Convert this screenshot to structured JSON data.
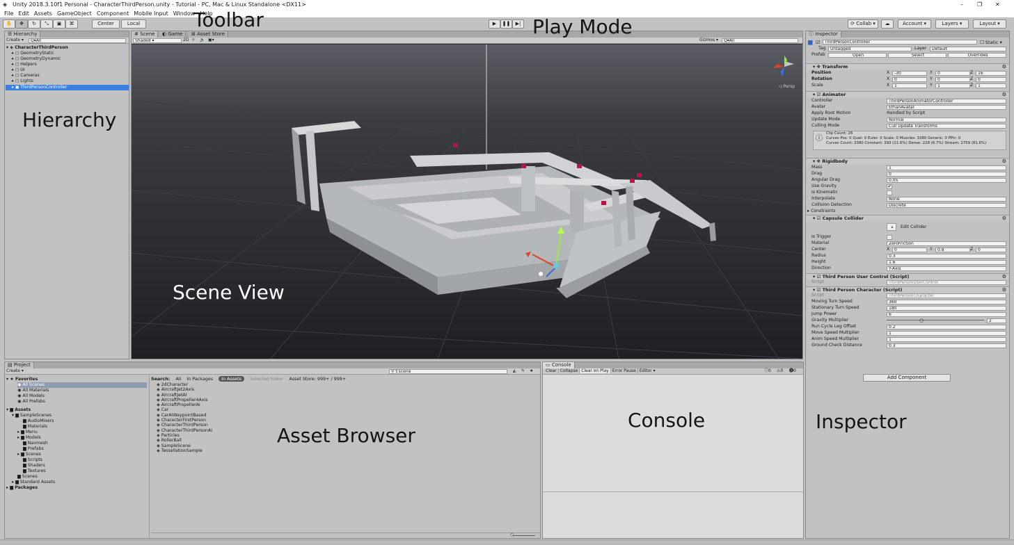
{
  "window": {
    "title": "Unity 2018.3.10f1 Personal - CharacterThirdPerson.unity - Tutorial - PC, Mac & Linux Standalone <DX11>",
    "minimize": "–",
    "maximize": "❐",
    "close": "✕"
  },
  "menu": [
    "File",
    "Edit",
    "Assets",
    "GameObject",
    "Component",
    "Mobile Input",
    "Window",
    "Help"
  ],
  "toolbar": {
    "pivot": "Center",
    "space": "Local",
    "collab": "Collab",
    "account": "Account",
    "layers": "Layers",
    "layout": "Layout",
    "play_icon": "play-icon",
    "pause_icon": "pause-icon",
    "step_icon": "step-icon"
  },
  "annotations": {
    "toolbar": "Toolbar",
    "play_mode": "Play Mode",
    "hierarchy": "Hierarchy",
    "scene_view": "Scene View",
    "asset_browser": "Asset Browser",
    "console": "Console",
    "inspector": "Inspector"
  },
  "hierarchy": {
    "tab": "Hierarchy",
    "create": "Create",
    "search": "Q▾All",
    "scene": "CharacterThirdPerson",
    "items": [
      "GeometryStatic",
      "GeometryDynamic",
      "Helpers",
      "UI",
      "Cameras",
      "Lights",
      "ThirdPersonController"
    ]
  },
  "scene": {
    "tabs": [
      "Scene",
      "Game",
      "Asset Store"
    ],
    "shading": "Shaded",
    "mode2d": "2D",
    "gizmos": "Gizmos",
    "search": "Q▾All",
    "persp": "◁ Persp"
  },
  "project": {
    "tab": "Project",
    "create": "Create",
    "search_field": "t:scene",
    "favorites_label": "Favorites",
    "favorites": [
      "All Scenes",
      "All Materials",
      "All Models",
      "All Prefabs"
    ],
    "assets_label": "Assets",
    "assets_tree": [
      "SampleScenes",
      "AudioMixers",
      "Materials",
      "Menu",
      "Models",
      "Navmesh",
      "Prefabs",
      "Scenes",
      "Scripts",
      "Shaders",
      "Textures",
      "Scenes",
      "Standard Assets"
    ],
    "packages_label": "Packages",
    "search_label": "Search:",
    "filters": [
      "All",
      "In Packages",
      "In Assets",
      "Selected folder",
      "Asset Store: 999+ / 999+"
    ],
    "results": [
      "2dCharacter",
      "AircraftJet2Axis",
      "AircraftJetAI",
      "AircraftPropeller4Axis",
      "AircraftPropellerAI",
      "Car",
      "CarAIWaypointBased",
      "CharacterFirstPerson",
      "CharacterThirdPerson",
      "CharacterThirdPersonAI",
      "Particles",
      "RollerBall",
      "SampleScene",
      "TessellationSample"
    ]
  },
  "console": {
    "tab": "Console",
    "buttons": [
      "Clear",
      "Collapse",
      "Clear on Play",
      "Error Pause",
      "Editor"
    ],
    "info_count": "0",
    "warn_count": "0",
    "error_count": "0"
  },
  "inspector": {
    "tab": "Inspector",
    "object_name": "ThirdPersonController",
    "static": "Static",
    "tag_label": "Tag",
    "tag": "Untagged",
    "layer_label": "Layer",
    "layer": "Default",
    "prefab_label": "Prefab",
    "prefab_buttons": [
      "Open",
      "Select",
      "Overrides"
    ],
    "transform": {
      "title": "Transform",
      "rows": [
        {
          "label": "Position",
          "x": "-30",
          "y": "0",
          "z": "16"
        },
        {
          "label": "Rotation",
          "x": "0",
          "y": "0",
          "z": "0"
        },
        {
          "label": "Scale",
          "x": "1",
          "y": "1",
          "z": "1"
        }
      ]
    },
    "animator": {
      "title": "Animator",
      "rows": [
        {
          "label": "Controller",
          "value": "ThirdPersonAnimatorController"
        },
        {
          "label": "Avatar",
          "value": "EthanAvatar"
        },
        {
          "label": "Apply Root Motion",
          "value": "Handled by Script"
        },
        {
          "label": "Update Mode",
          "value": "Normal"
        },
        {
          "label": "Culling Mode",
          "value": "Cull Update Transforms"
        }
      ],
      "info1": "Clip Count: 26",
      "info2": "Curves Pos: 0 Quat: 0 Euler: 0 Scale: 0 Muscles: 3380 Generic: 0 PPtr: 0",
      "info3": "Curves Count: 3380 Constant: 393 (11.6%) Dense: 228 (6.7%) Stream: 2759 (81.6%)"
    },
    "rigidbody": {
      "title": "Rigidbody",
      "rows": [
        {
          "label": "Mass",
          "value": "1"
        },
        {
          "label": "Drag",
          "value": "0"
        },
        {
          "label": "Angular Drag",
          "value": "0.05"
        },
        {
          "label": "Use Gravity",
          "value": "✔"
        },
        {
          "label": "Is Kinematic",
          "value": ""
        },
        {
          "label": "Interpolate",
          "value": "None"
        },
        {
          "label": "Collision Detection",
          "value": "Discrete"
        }
      ],
      "constraints": "Constraints"
    },
    "capsule": {
      "title": "Capsule Collider",
      "edit": "Edit Collider",
      "rows": [
        {
          "label": "Is Trigger",
          "value": ""
        },
        {
          "label": "Material",
          "value": "ZeroFriction"
        },
        {
          "label": "Radius",
          "value": "0.3"
        },
        {
          "label": "Height",
          "value": "1.6"
        },
        {
          "label": "Direction",
          "value": "Y-Axis"
        }
      ],
      "center_label": "Center",
      "center": {
        "x": "0",
        "y": "0.8",
        "z": "0"
      }
    },
    "user_control": {
      "title": "Third Person User Control (Script)",
      "script_label": "Script",
      "script": "ThirdPersonUserControl"
    },
    "character": {
      "title": "Third Person Character (Script)",
      "script_label": "Script",
      "script": "ThirdPersonCharacter",
      "rows": [
        {
          "label": "Moving Turn Speed",
          "value": "360"
        },
        {
          "label": "Stationary Turn Speed",
          "value": "180"
        },
        {
          "label": "Jump Power",
          "value": "6"
        },
        {
          "label": "Gravity Multiplier",
          "value": "2"
        },
        {
          "label": "Run Cycle Leg Offset",
          "value": "0.2"
        },
        {
          "label": "Move Speed Multiplier",
          "value": "1"
        },
        {
          "label": "Anim Speed Multiplier",
          "value": "1"
        },
        {
          "label": "Ground Check Distance",
          "value": "0.3"
        }
      ]
    },
    "add_component": "Add Component"
  }
}
